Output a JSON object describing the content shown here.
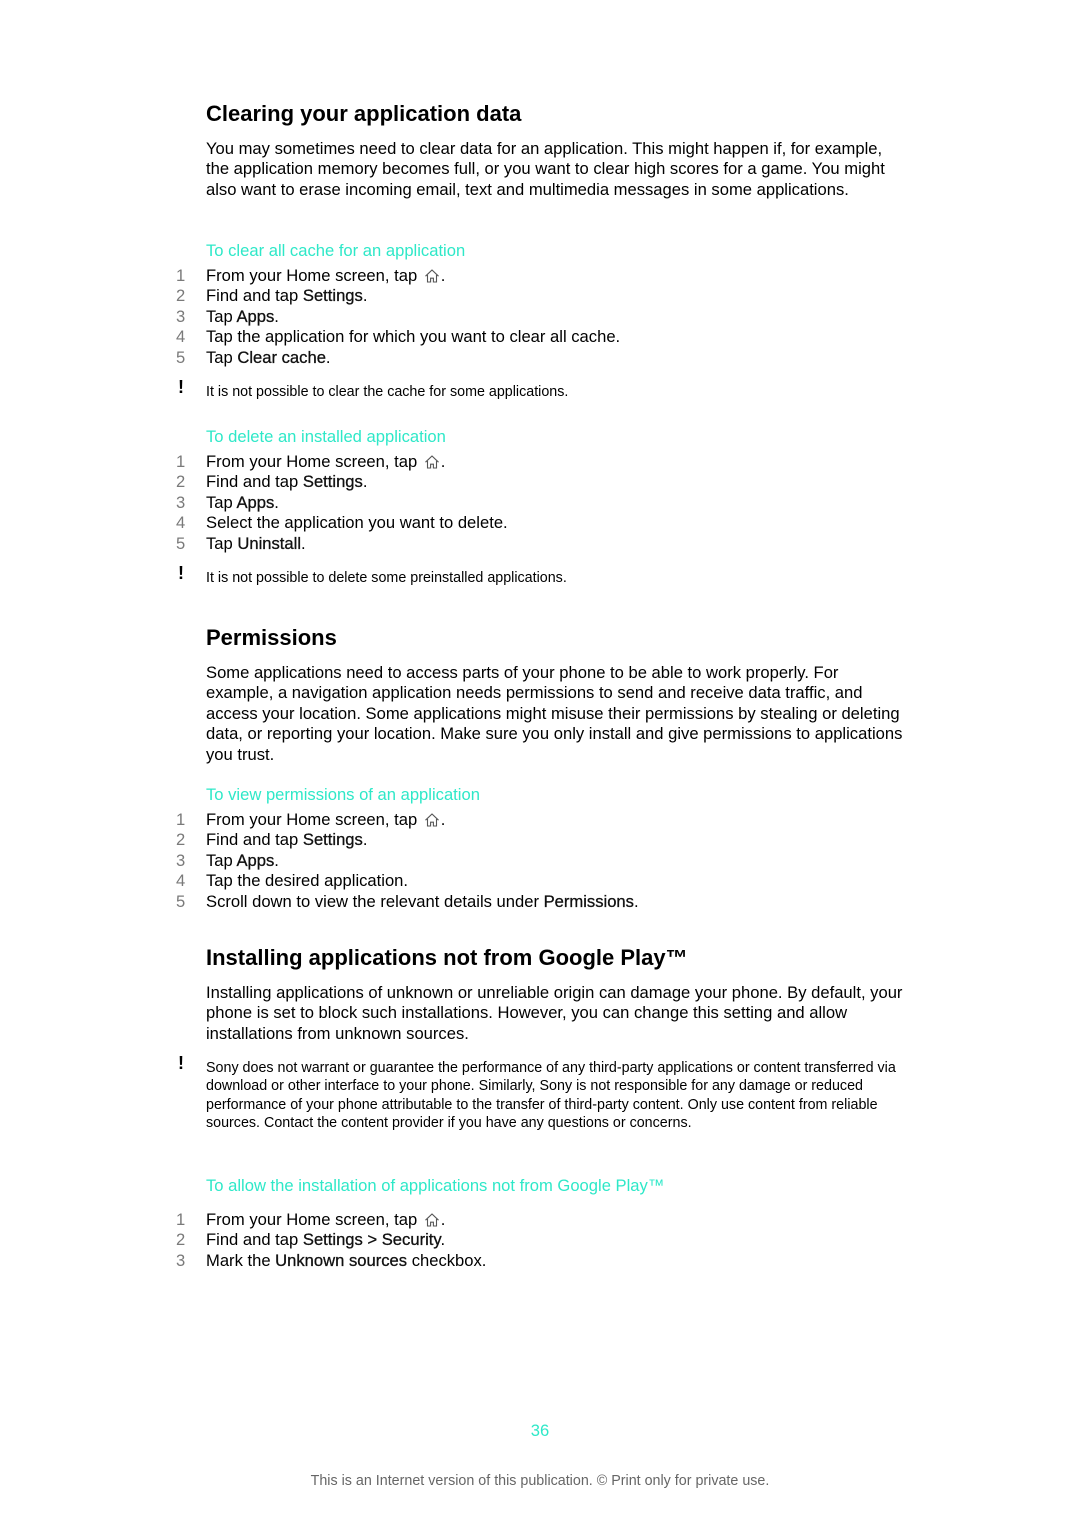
{
  "sections": [
    {
      "title": "Clearing your application data",
      "intro": "You may sometimes need to clear data for an application. This might happen if, for example, the application memory becomes full, or you want to clear high scores for a game. You might also want to erase incoming email, text and multimedia messages in some applications.",
      "procedures": [
        {
          "heading": "To clear all cache for an application",
          "steps": [
            {
              "num": "1",
              "pre": "From your Home screen, tap ",
              "bold": "",
              "post": ".",
              "icon": "home-icon"
            },
            {
              "num": "2",
              "pre": "Find and tap ",
              "bold": "Settings",
              "post": "."
            },
            {
              "num": "3",
              "pre": "Tap ",
              "bold": "Apps",
              "post": "."
            },
            {
              "num": "4",
              "pre": "Tap the application for which you want to clear all cache.",
              "bold": "",
              "post": ""
            },
            {
              "num": "5",
              "pre": "Tap ",
              "bold": "Clear cache",
              "post": "."
            }
          ],
          "note": "It is not possible to clear the cache for some applications."
        },
        {
          "heading": "To delete an installed application",
          "steps": [
            {
              "num": "1",
              "pre": "From your Home screen, tap ",
              "bold": "",
              "post": ".",
              "icon": "home-icon"
            },
            {
              "num": "2",
              "pre": "Find and tap ",
              "bold": "Settings",
              "post": "."
            },
            {
              "num": "3",
              "pre": "Tap ",
              "bold": "Apps",
              "post": "."
            },
            {
              "num": "4",
              "pre": "Select the application you want to delete.",
              "bold": "",
              "post": ""
            },
            {
              "num": "5",
              "pre": "Tap ",
              "bold": "Uninstall",
              "post": "."
            }
          ],
          "note": "It is not possible to delete some preinstalled applications."
        }
      ]
    },
    {
      "title": "Permissions",
      "intro": "Some applications need to access parts of your phone to be able to work properly. For example, a navigation application needs permissions to send and receive data traffic, and access your location. Some applications might misuse their permissions by stealing or deleting data, or reporting your location. Make sure you only install and give permissions to applications you trust.",
      "procedures": [
        {
          "heading": "To view permissions of an application",
          "steps": [
            {
              "num": "1",
              "pre": "From your Home screen, tap ",
              "bold": "",
              "post": ".",
              "icon": "home-icon"
            },
            {
              "num": "2",
              "pre": "Find and tap ",
              "bold": "Settings",
              "post": "."
            },
            {
              "num": "3",
              "pre": "Tap ",
              "bold": "Apps",
              "post": "."
            },
            {
              "num": "4",
              "pre": "Tap the desired application.",
              "bold": "",
              "post": ""
            },
            {
              "num": "5",
              "pre": "Scroll down to view the relevant details under ",
              "bold": "Permissions",
              "post": "."
            }
          ]
        }
      ]
    },
    {
      "title": "Installing applications not from Google Play™",
      "intro": "Installing applications of unknown or unreliable origin can damage your phone. By default, your phone is set to block such installations. However, you can change this setting and allow installations from unknown sources.",
      "warning": "Sony does not warrant or guarantee the performance of any third-party applications or content transferred via download or other interface to your phone. Similarly, Sony is not responsible for any damage or reduced performance of your phone attributable to the transfer of third-party content. Only use content from reliable sources. Contact the content provider if you have any questions or concerns.",
      "procedures": [
        {
          "heading": "To allow the installation of applications not from Google Play™",
          "steps": [
            {
              "num": "1",
              "pre": "From your Home screen, tap ",
              "bold": "",
              "post": ".",
              "icon": "home-icon"
            },
            {
              "num": "2",
              "pre": "Find and tap ",
              "bold": "Settings > Security",
              "post": "."
            },
            {
              "num": "3",
              "pre": "Mark the ",
              "bold": "Unknown sources",
              "post": " checkbox."
            }
          ]
        }
      ]
    }
  ],
  "note_icon": "exclamation-icon",
  "page_number": "36",
  "footer": "This is an Internet version of this publication. © Print only for private use.",
  "colors": {
    "accent": "#2ee8c8",
    "step_number": "#7a7a7a",
    "footer_text": "#666666",
    "text": "#000000"
  }
}
